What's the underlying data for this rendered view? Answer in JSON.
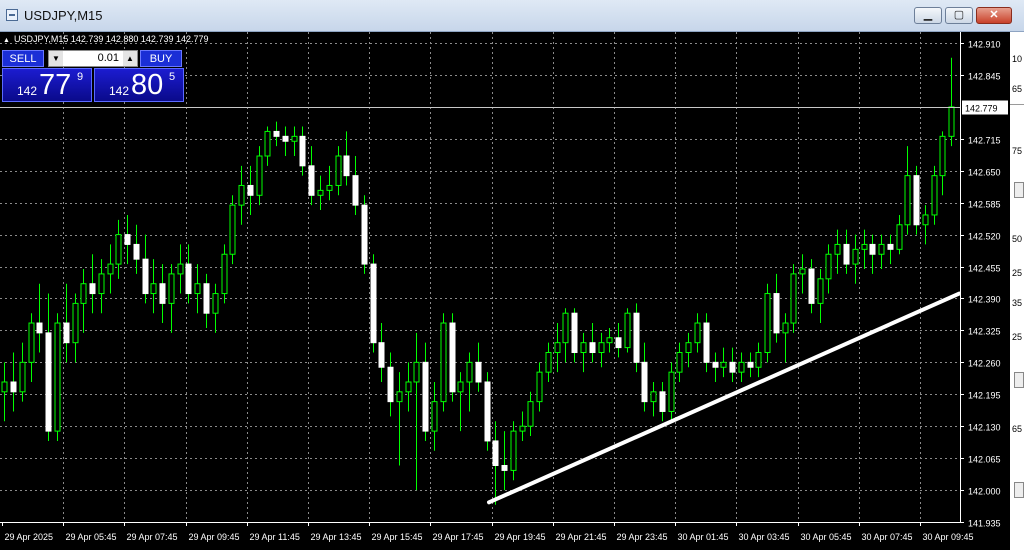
{
  "window": {
    "title": "USDJPY,M15",
    "buttons": {
      "minimize": "▁",
      "maximize": "▢",
      "close": "✕"
    }
  },
  "chart": {
    "ohlc_label": "USDJPY,M15  142.739 142.880 142.739 142.779",
    "current_price": "142.779",
    "price_min": 141.935,
    "price_max": 142.91,
    "price_labels": [
      "142.910",
      "142.845",
      "142.715",
      "142.650",
      "142.585",
      "142.520",
      "142.455",
      "142.390",
      "142.325",
      "142.260",
      "142.195",
      "142.130",
      "142.065",
      "142.000",
      "141.935"
    ],
    "time_labels": [
      "29 Apr 2025",
      "29 Apr 05:45",
      "29 Apr 07:45",
      "29 Apr 09:45",
      "29 Apr 11:45",
      "29 Apr 13:45",
      "29 Apr 15:45",
      "29 Apr 17:45",
      "29 Apr 19:45",
      "29 Apr 21:45",
      "29 Apr 23:45",
      "30 Apr 01:45",
      "30 Apr 03:45",
      "30 Apr 05:45",
      "30 Apr 07:45",
      "30 Apr 09:45"
    ],
    "trendline": {
      "start_price": 141.975,
      "end_price": 142.4
    },
    "colors": {
      "up": "#00ff00",
      "down": "#ffffff",
      "grid": "#8a8a8a",
      "background": "#000000",
      "trendline": "#ffffff"
    },
    "candles": [
      {
        "o": 142.2,
        "h": 142.26,
        "l": 142.14,
        "c": 142.22
      },
      {
        "o": 142.22,
        "h": 142.28,
        "l": 142.16,
        "c": 142.2
      },
      {
        "o": 142.2,
        "h": 142.3,
        "l": 142.18,
        "c": 142.26
      },
      {
        "o": 142.26,
        "h": 142.36,
        "l": 142.22,
        "c": 142.34
      },
      {
        "o": 142.34,
        "h": 142.42,
        "l": 142.28,
        "c": 142.32
      },
      {
        "o": 142.32,
        "h": 142.4,
        "l": 142.1,
        "c": 142.12
      },
      {
        "o": 142.12,
        "h": 142.36,
        "l": 142.1,
        "c": 142.34
      },
      {
        "o": 142.34,
        "h": 142.42,
        "l": 142.26,
        "c": 142.3
      },
      {
        "o": 142.3,
        "h": 142.4,
        "l": 142.26,
        "c": 142.38
      },
      {
        "o": 142.38,
        "h": 142.45,
        "l": 142.32,
        "c": 142.42
      },
      {
        "o": 142.42,
        "h": 142.48,
        "l": 142.36,
        "c": 142.4
      },
      {
        "o": 142.4,
        "h": 142.47,
        "l": 142.36,
        "c": 142.44
      },
      {
        "o": 142.44,
        "h": 142.5,
        "l": 142.4,
        "c": 142.46
      },
      {
        "o": 142.46,
        "h": 142.55,
        "l": 142.43,
        "c": 142.52
      },
      {
        "o": 142.52,
        "h": 142.56,
        "l": 142.46,
        "c": 142.5
      },
      {
        "o": 142.5,
        "h": 142.54,
        "l": 142.44,
        "c": 142.47
      },
      {
        "o": 142.47,
        "h": 142.52,
        "l": 142.38,
        "c": 142.4
      },
      {
        "o": 142.4,
        "h": 142.47,
        "l": 142.36,
        "c": 142.42
      },
      {
        "o": 142.42,
        "h": 142.46,
        "l": 142.34,
        "c": 142.38
      },
      {
        "o": 142.38,
        "h": 142.46,
        "l": 142.32,
        "c": 142.44
      },
      {
        "o": 142.44,
        "h": 142.5,
        "l": 142.4,
        "c": 142.46
      },
      {
        "o": 142.46,
        "h": 142.5,
        "l": 142.38,
        "c": 142.4
      },
      {
        "o": 142.4,
        "h": 142.46,
        "l": 142.36,
        "c": 142.42
      },
      {
        "o": 142.42,
        "h": 142.44,
        "l": 142.33,
        "c": 142.36
      },
      {
        "o": 142.36,
        "h": 142.42,
        "l": 142.32,
        "c": 142.4
      },
      {
        "o": 142.4,
        "h": 142.5,
        "l": 142.38,
        "c": 142.48
      },
      {
        "o": 142.48,
        "h": 142.6,
        "l": 142.46,
        "c": 142.58
      },
      {
        "o": 142.58,
        "h": 142.66,
        "l": 142.54,
        "c": 142.62
      },
      {
        "o": 142.62,
        "h": 142.66,
        "l": 142.56,
        "c": 142.6
      },
      {
        "o": 142.6,
        "h": 142.7,
        "l": 142.58,
        "c": 142.68
      },
      {
        "o": 142.68,
        "h": 142.74,
        "l": 142.66,
        "c": 142.73
      },
      {
        "o": 142.73,
        "h": 142.75,
        "l": 142.7,
        "c": 142.72
      },
      {
        "o": 142.72,
        "h": 142.74,
        "l": 142.68,
        "c": 142.71
      },
      {
        "o": 142.71,
        "h": 142.74,
        "l": 142.68,
        "c": 142.72
      },
      {
        "o": 142.72,
        "h": 142.74,
        "l": 142.64,
        "c": 142.66
      },
      {
        "o": 142.66,
        "h": 142.7,
        "l": 142.58,
        "c": 142.6
      },
      {
        "o": 142.6,
        "h": 142.64,
        "l": 142.57,
        "c": 142.61
      },
      {
        "o": 142.61,
        "h": 142.66,
        "l": 142.59,
        "c": 142.62
      },
      {
        "o": 142.62,
        "h": 142.7,
        "l": 142.6,
        "c": 142.68
      },
      {
        "o": 142.68,
        "h": 142.73,
        "l": 142.62,
        "c": 142.64
      },
      {
        "o": 142.64,
        "h": 142.68,
        "l": 142.56,
        "c": 142.58
      },
      {
        "o": 142.58,
        "h": 142.6,
        "l": 142.44,
        "c": 142.46
      },
      {
        "o": 142.46,
        "h": 142.48,
        "l": 142.28,
        "c": 142.3
      },
      {
        "o": 142.3,
        "h": 142.34,
        "l": 142.22,
        "c": 142.25
      },
      {
        "o": 142.25,
        "h": 142.28,
        "l": 142.15,
        "c": 142.18
      },
      {
        "o": 142.18,
        "h": 142.24,
        "l": 142.05,
        "c": 142.2
      },
      {
        "o": 142.2,
        "h": 142.26,
        "l": 142.16,
        "c": 142.22
      },
      {
        "o": 142.22,
        "h": 142.32,
        "l": 142.0,
        "c": 142.26
      },
      {
        "o": 142.26,
        "h": 142.3,
        "l": 142.1,
        "c": 142.12
      },
      {
        "o": 142.12,
        "h": 142.22,
        "l": 142.08,
        "c": 142.18
      },
      {
        "o": 142.18,
        "h": 142.36,
        "l": 142.16,
        "c": 142.34
      },
      {
        "o": 142.34,
        "h": 142.36,
        "l": 142.18,
        "c": 142.2
      },
      {
        "o": 142.2,
        "h": 142.24,
        "l": 142.12,
        "c": 142.22
      },
      {
        "o": 142.22,
        "h": 142.28,
        "l": 142.16,
        "c": 142.26
      },
      {
        "o": 142.26,
        "h": 142.3,
        "l": 142.2,
        "c": 142.22
      },
      {
        "o": 142.22,
        "h": 142.24,
        "l": 142.08,
        "c": 142.1
      },
      {
        "o": 142.1,
        "h": 142.14,
        "l": 141.97,
        "c": 142.05
      },
      {
        "o": 142.05,
        "h": 142.12,
        "l": 142.0,
        "c": 142.04
      },
      {
        "o": 142.04,
        "h": 142.14,
        "l": 142.02,
        "c": 142.12
      },
      {
        "o": 142.12,
        "h": 142.16,
        "l": 142.1,
        "c": 142.13
      },
      {
        "o": 142.13,
        "h": 142.2,
        "l": 142.11,
        "c": 142.18
      },
      {
        "o": 142.18,
        "h": 142.26,
        "l": 142.16,
        "c": 142.24
      },
      {
        "o": 142.24,
        "h": 142.3,
        "l": 142.22,
        "c": 142.28
      },
      {
        "o": 142.28,
        "h": 142.34,
        "l": 142.24,
        "c": 142.3
      },
      {
        "o": 142.3,
        "h": 142.37,
        "l": 142.26,
        "c": 142.36
      },
      {
        "o": 142.36,
        "h": 142.37,
        "l": 142.26,
        "c": 142.28
      },
      {
        "o": 142.28,
        "h": 142.32,
        "l": 142.24,
        "c": 142.3
      },
      {
        "o": 142.3,
        "h": 142.34,
        "l": 142.26,
        "c": 142.28
      },
      {
        "o": 142.28,
        "h": 142.32,
        "l": 142.25,
        "c": 142.3
      },
      {
        "o": 142.3,
        "h": 142.33,
        "l": 142.28,
        "c": 142.31
      },
      {
        "o": 142.31,
        "h": 142.34,
        "l": 142.27,
        "c": 142.29
      },
      {
        "o": 142.29,
        "h": 142.37,
        "l": 142.28,
        "c": 142.36
      },
      {
        "o": 142.36,
        "h": 142.38,
        "l": 142.24,
        "c": 142.26
      },
      {
        "o": 142.26,
        "h": 142.3,
        "l": 142.16,
        "c": 142.18
      },
      {
        "o": 142.18,
        "h": 142.22,
        "l": 142.15,
        "c": 142.2
      },
      {
        "o": 142.2,
        "h": 142.22,
        "l": 142.14,
        "c": 142.16
      },
      {
        "o": 142.16,
        "h": 142.26,
        "l": 142.14,
        "c": 142.24
      },
      {
        "o": 142.24,
        "h": 142.3,
        "l": 142.22,
        "c": 142.28
      },
      {
        "o": 142.28,
        "h": 142.32,
        "l": 142.25,
        "c": 142.3
      },
      {
        "o": 142.3,
        "h": 142.36,
        "l": 142.28,
        "c": 142.34
      },
      {
        "o": 142.34,
        "h": 142.36,
        "l": 142.24,
        "c": 142.26
      },
      {
        "o": 142.26,
        "h": 142.28,
        "l": 142.22,
        "c": 142.25
      },
      {
        "o": 142.25,
        "h": 142.29,
        "l": 142.23,
        "c": 142.26
      },
      {
        "o": 142.26,
        "h": 142.29,
        "l": 142.22,
        "c": 142.24
      },
      {
        "o": 142.24,
        "h": 142.28,
        "l": 142.22,
        "c": 142.26
      },
      {
        "o": 142.26,
        "h": 142.28,
        "l": 142.23,
        "c": 142.25
      },
      {
        "o": 142.25,
        "h": 142.3,
        "l": 142.23,
        "c": 142.28
      },
      {
        "o": 142.28,
        "h": 142.42,
        "l": 142.26,
        "c": 142.4
      },
      {
        "o": 142.4,
        "h": 142.44,
        "l": 142.3,
        "c": 142.32
      },
      {
        "o": 142.32,
        "h": 142.36,
        "l": 142.26,
        "c": 142.34
      },
      {
        "o": 142.34,
        "h": 142.46,
        "l": 142.32,
        "c": 142.44
      },
      {
        "o": 142.44,
        "h": 142.48,
        "l": 142.4,
        "c": 142.45
      },
      {
        "o": 142.45,
        "h": 142.47,
        "l": 142.36,
        "c": 142.38
      },
      {
        "o": 142.38,
        "h": 142.45,
        "l": 142.34,
        "c": 142.43
      },
      {
        "o": 142.43,
        "h": 142.5,
        "l": 142.4,
        "c": 142.48
      },
      {
        "o": 142.48,
        "h": 142.53,
        "l": 142.44,
        "c": 142.5
      },
      {
        "o": 142.5,
        "h": 142.53,
        "l": 142.44,
        "c": 142.46
      },
      {
        "o": 142.46,
        "h": 142.52,
        "l": 142.42,
        "c": 142.49
      },
      {
        "o": 142.49,
        "h": 142.53,
        "l": 142.45,
        "c": 142.5
      },
      {
        "o": 142.5,
        "h": 142.52,
        "l": 142.44,
        "c": 142.48
      },
      {
        "o": 142.48,
        "h": 142.52,
        "l": 142.45,
        "c": 142.5
      },
      {
        "o": 142.5,
        "h": 142.52,
        "l": 142.46,
        "c": 142.49
      },
      {
        "o": 142.49,
        "h": 142.56,
        "l": 142.48,
        "c": 142.54
      },
      {
        "o": 142.54,
        "h": 142.7,
        "l": 142.52,
        "c": 142.64
      },
      {
        "o": 142.64,
        "h": 142.66,
        "l": 142.52,
        "c": 142.54
      },
      {
        "o": 142.54,
        "h": 142.58,
        "l": 142.5,
        "c": 142.56
      },
      {
        "o": 142.56,
        "h": 142.66,
        "l": 142.54,
        "c": 142.64
      },
      {
        "o": 142.64,
        "h": 142.73,
        "l": 142.6,
        "c": 142.72
      },
      {
        "o": 142.72,
        "h": 142.88,
        "l": 142.7,
        "c": 142.78
      }
    ]
  },
  "trade_panel": {
    "sell_label": "SELL",
    "buy_label": "BUY",
    "lot_value": "0.01",
    "sell": {
      "small": "142",
      "big": "77",
      "sup": "9"
    },
    "buy": {
      "small": "142",
      "big": "80",
      "sup": "5"
    }
  },
  "right_strip": {
    "labels": [
      "10",
      "65",
      "75",
      "50",
      "25",
      "35",
      "25",
      "65"
    ]
  }
}
